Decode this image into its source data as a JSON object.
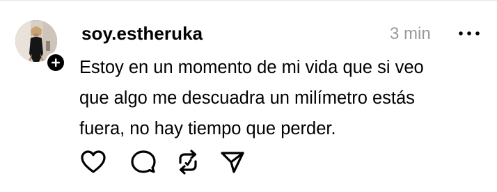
{
  "post": {
    "username": "soy.estheruka",
    "timestamp": "3 min",
    "text_lines": [
      "Estoy en un momento de mi vida que si veo",
      "que algo me descuadra un milímetro estás",
      "fuera, no hay tiempo que perder."
    ],
    "avatar_icon": "profile-photo",
    "follow_icon": "plus-icon"
  },
  "actions": [
    {
      "icon": "heart-icon"
    },
    {
      "icon": "comment-icon"
    },
    {
      "icon": "repost-icon"
    },
    {
      "icon": "share-icon"
    }
  ],
  "colors": {
    "text": "#000000",
    "timestamp": "#999999",
    "background": "#ffffff",
    "divider": "#e6e6e6"
  }
}
